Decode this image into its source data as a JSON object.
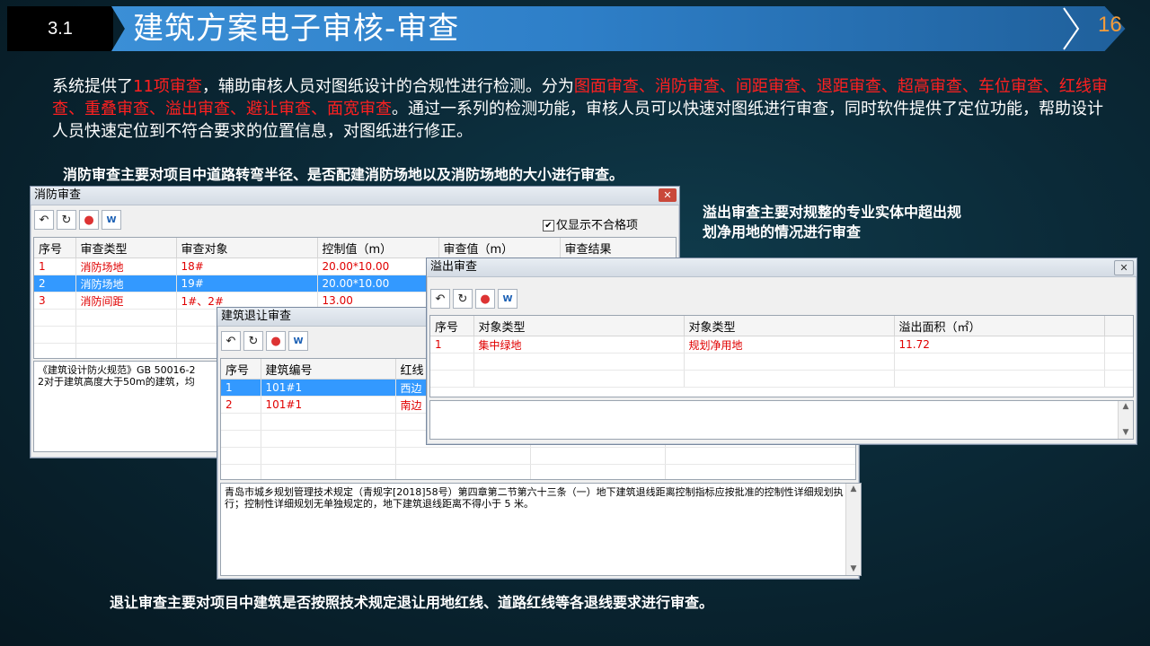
{
  "header": {
    "section": "3.1",
    "title": "建筑方案电子审核-审查",
    "page": "16"
  },
  "intro": {
    "p1": "系统提供了",
    "r1": "11项审查",
    "p2": "，辅助审核人员对图纸设计的合规性进行检测。分为",
    "r2": "图面审查、消防审查、间距审查、退距审查、超高审查、车位审查、红线审查、重叠审查、溢出审查、避让审查、面宽审查",
    "p3": "。通过一系列的检测功能，审核人员可以快速对图纸进行审查，同时软件提供了定位功能，帮助设计人员快速定位到不符合要求的位置信息，对图纸进行修正。"
  },
  "captions": {
    "fire": "消防审查主要对项目中道路转弯半径、是否配建消防场地以及消防场地的大小进行审查。",
    "overflow": "溢出审查主要对规整的专业实体中超出规划净用地的情况进行审查",
    "setback": "退让审查主要对项目中建筑是否按照技术规定退让用地红线、道路红线等各退线要求进行审查。"
  },
  "fire_window": {
    "title": "消防审查",
    "checkbox_label": "仅显示不合格项",
    "columns": [
      "序号",
      "审查类型",
      "审查对象",
      "控制值（m）",
      "审查值（m）",
      "审查结果"
    ],
    "rows": [
      [
        "1",
        "消防场地",
        "18#",
        "20.00*10.00",
        "",
        ""
      ],
      [
        "2",
        "消防场地",
        "19#",
        "20.00*10.00",
        "",
        ""
      ],
      [
        "3",
        "消防间距",
        "1#、2#",
        "13.00",
        "",
        ""
      ]
    ],
    "note_line1": "《建筑设计防火规范》GB 50016-2",
    "note_line2": "2对于建筑高度大于50m的建筑，均"
  },
  "setback_window": {
    "title": "建筑退让审查",
    "columns": [
      "序号",
      "建筑编号",
      "红线"
    ],
    "rows": [
      [
        "1",
        "101#1",
        "西边"
      ],
      [
        "2",
        "101#1",
        "南边"
      ]
    ],
    "note": "青岛市城乡规划管理技术规定（青规字[2018]58号）第四章第二节第六十三条（一）地下建筑退线距离控制指标应按批准的控制性详细规划执行；控制性详细规划无单独规定的，地下建筑退线距离不得小于 5 米。"
  },
  "overflow_window": {
    "title": "溢出审查",
    "columns": [
      "序号",
      "对象类型",
      "对象类型",
      "溢出面积（㎡）"
    ],
    "rows": [
      [
        "1",
        "集中绿地",
        "规划净用地",
        "11.72"
      ]
    ]
  },
  "colors": {
    "accent_red": "#ff2020",
    "header_blue": "#2e7fc8",
    "page_orange": "#f39c3a",
    "selection": "#3399ff"
  },
  "icons": [
    "undo-icon",
    "refresh-icon",
    "locate-pin-icon",
    "word-export-icon",
    "close-icon",
    "scroll-up-icon",
    "scroll-down-icon"
  ]
}
